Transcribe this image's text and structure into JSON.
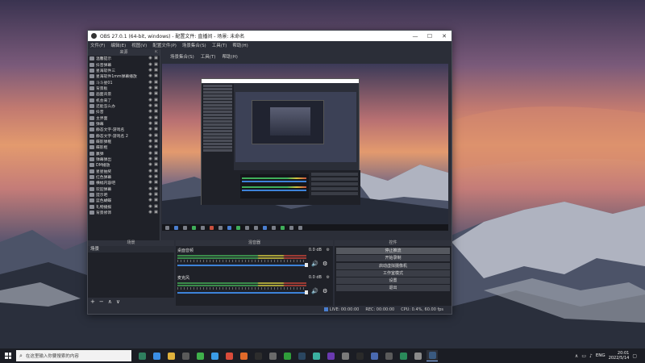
{
  "window": {
    "title": "OBS 27.0.1 (64-bit, windows) - 配置文件: 直播间 - 场景: 未命名",
    "minimize": "—",
    "maximize": "☐",
    "close": "✕"
  },
  "menu": [
    "文件(F)",
    "编辑(E)",
    "视图(V)",
    "配置文件(P)",
    "场景集合(S)",
    "工具(T)",
    "帮助(H)"
  ],
  "sources_panel": {
    "title": "来源",
    "items": [
      "温馨提示",
      "抖音弹幕",
      "星海软件三",
      "星海软件1mm弹幕播放",
      "斗斗星01",
      "背景板",
      "画面背景",
      "机会来了",
      "还能怎么办",
      "抖音",
      "主界面",
      "弹幕",
      "静态文字-游戏名",
      "静态文字-游戏名 2",
      "蝶影弹框",
      "蝶影框",
      "赢弹",
      "弹幕弹出",
      "DM播放",
      "星星抽奖",
      "红色弹幕",
      "横幅内容吧",
      "欢迎弹幕",
      "提示吧",
      "蓝色蝴蝶",
      "礼物播报",
      "背景修饰"
    ],
    "tools": [
      "+",
      "−",
      "⚙",
      "∧",
      "∨"
    ]
  },
  "preview_menu": [
    "场景集合(S)",
    "工具(T)",
    "帮助(H)"
  ],
  "scenes_panel": {
    "title": "场景",
    "items": [
      "场景"
    ],
    "tools": [
      "+",
      "−",
      "∧",
      "∨"
    ]
  },
  "mixer_panel": {
    "title": "混音器",
    "channels": [
      {
        "name": "桌面音频",
        "db": "0.0 dB"
      },
      {
        "name": "麦克风",
        "db": "0.0 dB"
      }
    ]
  },
  "controls_panel": {
    "title": "控件",
    "buttons": [
      "停止推流",
      "开始录制",
      "启动虚拟摄像机",
      "工作室模式",
      "设置",
      "退出"
    ]
  },
  "status": {
    "live": "LIVE: 00:00:00",
    "rec": "REC: 00:00:00",
    "cpu": "CPU: 0.4%, 60.00 fps"
  },
  "taskbar": {
    "search_placeholder": "在这里输入你要搜索的内容",
    "icons": [
      {
        "name": "task-view-icon",
        "color": "#2f7f5f"
      },
      {
        "name": "edge-icon",
        "color": "#3a8ee6"
      },
      {
        "name": "file-explorer-icon",
        "color": "#e0b23c"
      },
      {
        "name": "store-icon",
        "color": "#5a5a5a"
      },
      {
        "name": "wechat-icon",
        "color": "#3fb04b"
      },
      {
        "name": "qq-icon",
        "color": "#3a9be6"
      },
      {
        "name": "chrome-icon",
        "color": "#d94b3a"
      },
      {
        "name": "app-icon",
        "color": "#e06a2a"
      },
      {
        "name": "app2-icon",
        "color": "#2d2d2d"
      },
      {
        "name": "obs-icon",
        "color": "#6a6a6a"
      },
      {
        "name": "xbox-icon",
        "color": "#2f9e3a"
      },
      {
        "name": "steam-icon",
        "color": "#2a4660"
      },
      {
        "name": "game-icon",
        "color": "#3ab0a0"
      },
      {
        "name": "app3-icon",
        "color": "#6a3ab0"
      },
      {
        "name": "gear-icon",
        "color": "#7a7a7a"
      },
      {
        "name": "app4-icon",
        "color": "#2a2a2a"
      },
      {
        "name": "speed-icon",
        "color": "#4a6ab0"
      },
      {
        "name": "app5-icon",
        "color": "#5a5a5a"
      },
      {
        "name": "app6-icon",
        "color": "#2a8a5a"
      },
      {
        "name": "app7-icon",
        "color": "#8a8a8a"
      },
      {
        "name": "steam2-icon",
        "color": "#3a5a80"
      }
    ],
    "lang": "ENG",
    "time": "20:01",
    "date": "2022/5/14"
  }
}
